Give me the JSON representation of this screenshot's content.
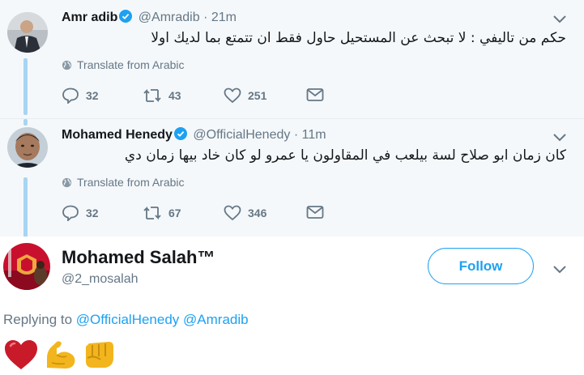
{
  "tweets": [
    {
      "name": "Amr adib",
      "handle": "@Amradib",
      "separator": "·",
      "time": "21m",
      "text": "حكم من تاليفي : لا تبحث عن المستحيل حاول فقط ان تتمتع بما لديك اولا",
      "translate": "Translate from Arabic",
      "replies": "32",
      "retweets": "43",
      "likes": "251"
    },
    {
      "name": "Mohamed Henedy",
      "handle": "@OfficialHenedy",
      "separator": "·",
      "time": "11m",
      "text": "كان زمان ابو صلاح لسة بيلعب في المقاولون يا عمرو لو كان خاد بيها زمان دي",
      "translate": "Translate from Arabic",
      "replies": "32",
      "retweets": "67",
      "likes": "346"
    }
  ],
  "profile": {
    "name": "Mohamed Salah™",
    "handle": "@2_mosalah",
    "follow_label": "Follow"
  },
  "reply": {
    "prefix": "Replying to",
    "mentions": [
      "@OfficialHenedy",
      "@Amradib"
    ]
  },
  "colors": {
    "accent": "#1da1f2",
    "muted": "#657786",
    "thread_line": "#a6d5f2",
    "tweet_bg": "#f5f8fa"
  },
  "icons": [
    "verified-badge-icon",
    "chevron-down-icon",
    "globe-icon",
    "reply-icon",
    "retweet-icon",
    "like-icon",
    "direct-message-icon",
    "red-heart-emoji",
    "flexed-biceps-emoji",
    "fist-emoji"
  ]
}
